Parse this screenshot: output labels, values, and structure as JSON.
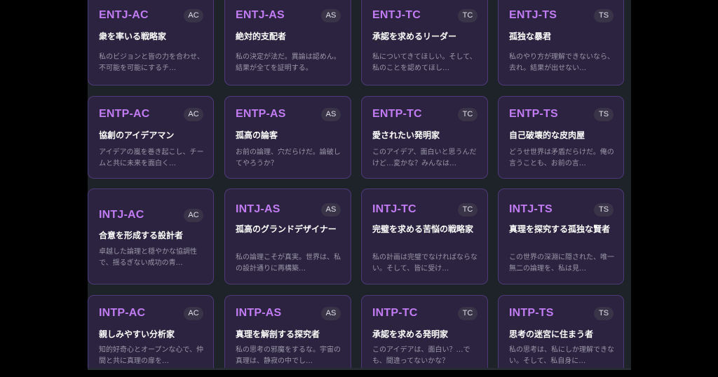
{
  "colors": {
    "accent": "#c27cf3",
    "card_bg": "#2b2340",
    "card_border": "#4f3a78",
    "page_bg": "#1e2329"
  },
  "rows": [
    [
      {
        "code": "ENTJ-AC",
        "badge": "AC",
        "title": "衆を率いる戦略家",
        "desc": "私のビジョンと皆の力を合わせ、不可能を可能にするチ…"
      },
      {
        "code": "ENTJ-AS",
        "badge": "AS",
        "title": "絶対的支配者",
        "desc": "私の決定が法だ。異論は認めん。結果が全てを証明する。"
      },
      {
        "code": "ENTJ-TC",
        "badge": "TC",
        "title": "承認を求めるリーダー",
        "desc": "私についてきてほしい。そして、私のことを認めてほし…"
      },
      {
        "code": "ENTJ-TS",
        "badge": "TS",
        "title": "孤独な暴君",
        "desc": "私のやり方が理解できないなら、去れ。結果が出せない…"
      }
    ],
    [
      {
        "code": "ENTP-AC",
        "badge": "AC",
        "title": "協創のアイデアマン",
        "desc": "アイデアの嵐を巻き起こし、チームと共に未来を面白く…"
      },
      {
        "code": "ENTP-AS",
        "badge": "AS",
        "title": "孤高の論客",
        "desc": "お前の論理、穴だらけだ。論破してやろうか？"
      },
      {
        "code": "ENTP-TC",
        "badge": "TC",
        "title": "愛されたい発明家",
        "desc": "このアイデア、面白いと思うんだけど…変かな？みんなは…"
      },
      {
        "code": "ENTP-TS",
        "badge": "TS",
        "title": "自己破壊的な皮肉屋",
        "desc": "どうせ世界は矛盾だらけだ。俺の言うことも、お前の言…"
      }
    ],
    [
      {
        "code": "INTJ-AC",
        "badge": "AC",
        "title": "合意を形成する設計者",
        "desc": "卓越した論理と穏やかな協調性で、揺るぎない成功の青…"
      },
      {
        "code": "INTJ-AS",
        "badge": "AS",
        "title": "孤高のグランドデザイナー",
        "desc": "私の論理こそが真実。世界は、私の設計通りに再構築…"
      },
      {
        "code": "INTJ-TC",
        "badge": "TC",
        "title": "完璧を求める苦悩の戦略家",
        "desc": "私の計画は完璧でなければならない。そして、皆に受け…"
      },
      {
        "code": "INTJ-TS",
        "badge": "TS",
        "title": "真理を探究する孤独な賢者",
        "desc": "この世界の深淵に隠された、唯一無二の論理を、私は見…"
      }
    ],
    [
      {
        "code": "INTP-AC",
        "badge": "AC",
        "title": "親しみやすい分析家",
        "desc": "知的好奇心とオープンな心で、仲間と共に真理の扉を…"
      },
      {
        "code": "INTP-AS",
        "badge": "AS",
        "title": "真理を解剖する探究者",
        "desc": "私の思考の邪魔をするな。宇宙の真理は、静寂の中でし…"
      },
      {
        "code": "INTP-TC",
        "badge": "TC",
        "title": "承認を求める発明家",
        "desc": "このアイデアは、面白い？…でも、間違ってないかな？"
      },
      {
        "code": "INTP-TS",
        "badge": "TS",
        "title": "思考の迷宮に住まう者",
        "desc": "私の思考は、私にしか理解できない。そして、私自身に…"
      }
    ]
  ]
}
